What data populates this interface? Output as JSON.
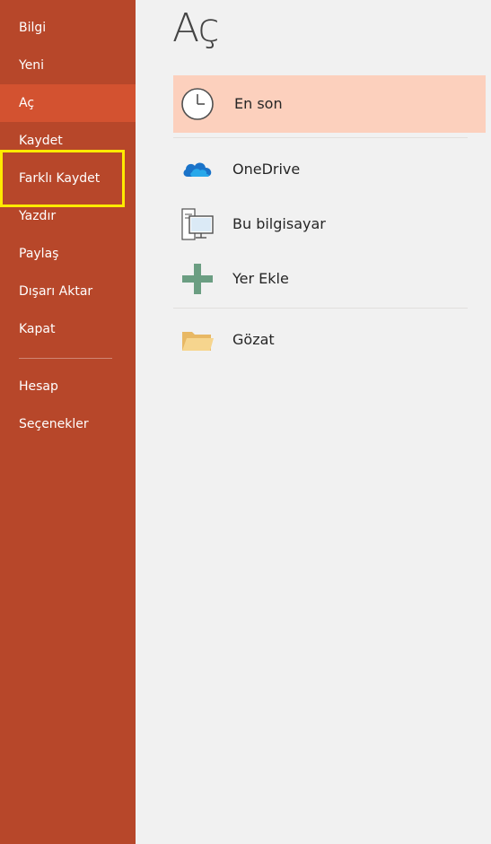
{
  "sidebar": {
    "items": [
      {
        "label": "Bilgi"
      },
      {
        "label": "Yeni"
      },
      {
        "label": "Aç"
      },
      {
        "label": "Kaydet"
      },
      {
        "label": "Farklı Kaydet"
      },
      {
        "label": "Yazdır"
      },
      {
        "label": "Paylaş"
      },
      {
        "label": "Dışarı Aktar"
      },
      {
        "label": "Kapat"
      },
      {
        "label": "Hesap"
      },
      {
        "label": "Seçenekler"
      }
    ],
    "active_item": "Aç",
    "highlighted_item": "Farklı Kaydet"
  },
  "main": {
    "title": "Aç",
    "locations": [
      {
        "label": "En son",
        "icon": "clock-icon"
      },
      {
        "label": "OneDrive",
        "icon": "onedrive-cloud-icon"
      },
      {
        "label": "Bu bilgisayar",
        "icon": "computer-icon"
      },
      {
        "label": "Yer Ekle",
        "icon": "plus-icon"
      },
      {
        "label": "Gözat",
        "icon": "folder-icon"
      }
    ]
  },
  "colors": {
    "sidebar_bg": "#b7472a",
    "active_item_bg": "#d35230",
    "highlight_border": "#ffea00",
    "selected_location_bg": "#fcd0bd",
    "main_bg": "#f1f1f1"
  }
}
